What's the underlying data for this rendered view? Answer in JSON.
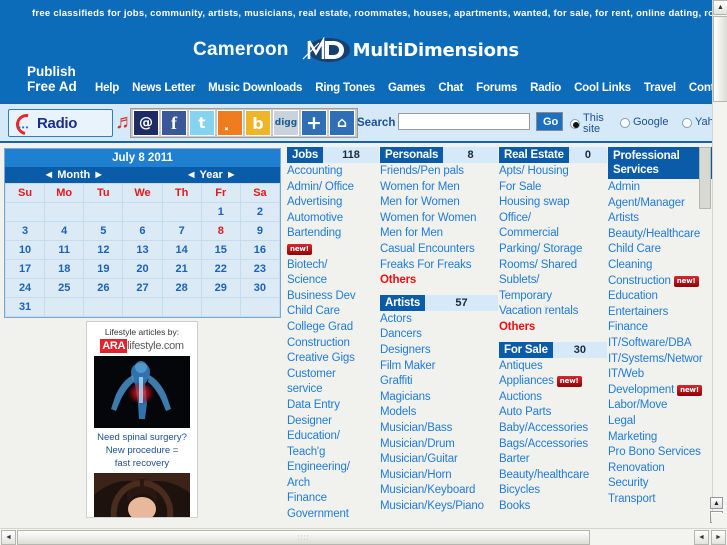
{
  "banner": {
    "tagline": "free classifieds for jobs, community, artists, musicians, real estate, roommates, houses, apartments, wanted, for sale, for rent, online dating, romance, p",
    "logo_country": "Cameroon",
    "logo_brand": "MultiDimensions",
    "publish_line1": "Publish",
    "publish_line2": "Free Ad"
  },
  "nav": {
    "items": [
      "Help",
      "News Letter",
      "Music Downloads",
      "Ring Tones",
      "Games",
      "Chat",
      "Forums",
      "Radio",
      "Cool Links",
      "Travel",
      "Contac"
    ]
  },
  "toolbar": {
    "radio_label": "Radio",
    "icons": [
      {
        "name": "email-icon",
        "glyph": "@"
      },
      {
        "name": "facebook-icon",
        "glyph": "f"
      },
      {
        "name": "twitter-icon",
        "glyph": "t"
      },
      {
        "name": "rss-icon",
        "glyph": "͓"
      },
      {
        "name": "bebo-icon",
        "glyph": "b"
      },
      {
        "name": "digg-icon",
        "glyph": "digg"
      },
      {
        "name": "addthis-icon",
        "glyph": "+"
      },
      {
        "name": "home-icon",
        "glyph": "⌂"
      }
    ],
    "search_label": "Search",
    "search_value": "",
    "search_placeholder": "",
    "go_label": "Go",
    "scope_options": [
      "This site",
      "Google",
      "Yahoo"
    ],
    "scope_selected": "This site"
  },
  "calendar": {
    "title": "July 8 2011",
    "month_nav": "◄ Month ►",
    "year_nav": "◄ Year ►",
    "daynames": [
      "Su",
      "Mo",
      "Tu",
      "We",
      "Th",
      "Fr",
      "Sa"
    ],
    "weeks": [
      [
        "",
        "",
        "",
        "",
        "",
        "1",
        "2"
      ],
      [
        "3",
        "4",
        "5",
        "6",
        "7",
        "8",
        "9"
      ],
      [
        "10",
        "11",
        "12",
        "13",
        "14",
        "15",
        "16"
      ],
      [
        "17",
        "18",
        "19",
        "20",
        "21",
        "22",
        "23"
      ],
      [
        "24",
        "25",
        "26",
        "27",
        "28",
        "29",
        "30"
      ],
      [
        "31",
        "",
        "",
        "",
        "",
        "",
        ""
      ]
    ],
    "today": "8"
  },
  "ad": {
    "header": "Lifestyle articles by:",
    "logo_red": "ARA",
    "logo_rest": "lifestyle.com",
    "caption_line1": "Need spinal surgery?",
    "caption_line2": "New procedure =",
    "caption_line3": "fast recovery"
  },
  "categories": [
    {
      "id": "jobs",
      "title": "Jobs",
      "count": "118",
      "items": [
        {
          "label": "Accounting"
        },
        {
          "label": "Admin/ Office"
        },
        {
          "label": "Advertising"
        },
        {
          "label": "Automotive"
        },
        {
          "label": "Bartending"
        },
        {
          "label": "",
          "badge": "new!"
        },
        {
          "label": "Biotech/"
        },
        {
          "label": "Science"
        },
        {
          "label": "Business Dev"
        },
        {
          "label": "Child Care"
        },
        {
          "label": "College Grad"
        },
        {
          "label": "Construction"
        },
        {
          "label": "Creative Gigs"
        },
        {
          "label": "Customer"
        },
        {
          "label": "service"
        },
        {
          "label": "Data Entry"
        },
        {
          "label": "Designer"
        },
        {
          "label": "Education/"
        },
        {
          "label": "Teach'g"
        },
        {
          "label": "Engineering/"
        },
        {
          "label": "Arch"
        },
        {
          "label": "Finance"
        },
        {
          "label": "Government"
        }
      ]
    },
    {
      "id": "personals",
      "title": "Personals",
      "count": "8",
      "items": [
        {
          "label": "Friends/Pen pals"
        },
        {
          "label": "Women for Men"
        },
        {
          "label": "Men for Women"
        },
        {
          "label": "Women for Women"
        },
        {
          "label": "Men for Men"
        },
        {
          "label": "Casual Encounters"
        },
        {
          "label": "Freaks For Freaks"
        },
        {
          "label": "Others",
          "others": true
        }
      ]
    },
    {
      "id": "artists",
      "title": "Artists",
      "count": "57",
      "items": [
        {
          "label": "Actors"
        },
        {
          "label": "Dancers"
        },
        {
          "label": "Designers"
        },
        {
          "label": "Film Maker"
        },
        {
          "label": "Graffiti"
        },
        {
          "label": "Magicians"
        },
        {
          "label": "Models"
        },
        {
          "label": "Musician/Bass"
        },
        {
          "label": "Musician/Drum"
        },
        {
          "label": "Musician/Guitar"
        },
        {
          "label": "Musician/Horn"
        },
        {
          "label": "Musician/Keyboard"
        },
        {
          "label": "Musician/Keys/Piano"
        }
      ]
    },
    {
      "id": "real-estate",
      "title": "Real Estate",
      "count": "0",
      "items": [
        {
          "label": "Apts/ Housing"
        },
        {
          "label": "For Sale"
        },
        {
          "label": "Housing swap"
        },
        {
          "label": "Office/"
        },
        {
          "label": "Commercial"
        },
        {
          "label": "Parking/ Storage"
        },
        {
          "label": "Rooms/ Shared"
        },
        {
          "label": "Sublets/"
        },
        {
          "label": "Temporary"
        },
        {
          "label": "Vacation rentals"
        },
        {
          "label": "Others",
          "others": true
        }
      ]
    },
    {
      "id": "for-sale",
      "title": "For Sale",
      "count": "30",
      "items": [
        {
          "label": "Antiques"
        },
        {
          "label": "Appliances",
          "badge": "new!"
        },
        {
          "label": "Auctions"
        },
        {
          "label": "Auto Parts"
        },
        {
          "label": "Baby/Accessories"
        },
        {
          "label": "Bags/Accessories"
        },
        {
          "label": "Barter"
        },
        {
          "label": "Beauty/healthcare"
        },
        {
          "label": "Bicycles"
        },
        {
          "label": "Books"
        }
      ]
    },
    {
      "id": "professional-services",
      "title": "Professional Services",
      "count": "",
      "items": [
        {
          "label": "Admin"
        },
        {
          "label": "Agent/Manager"
        },
        {
          "label": "Artists"
        },
        {
          "label": "Beauty/Healthcare"
        },
        {
          "label": "Child Care"
        },
        {
          "label": "Cleaning"
        },
        {
          "label": "Construction",
          "badge": "new!"
        },
        {
          "label": "Education"
        },
        {
          "label": "Entertainers"
        },
        {
          "label": "Finance"
        },
        {
          "label": "IT/Software/DBA"
        },
        {
          "label": "IT/Systems/Networ"
        },
        {
          "label": "IT/Web"
        },
        {
          "label": "Development",
          "badge": "new!"
        },
        {
          "label": "Labor/Move"
        },
        {
          "label": "Legal"
        },
        {
          "label": "Marketing"
        },
        {
          "label": "Pro Bono Services"
        },
        {
          "label": "Renovation"
        },
        {
          "label": "Security"
        },
        {
          "label": "Transport"
        }
      ]
    }
  ],
  "colors": {
    "banner_blue": "#0d6cb9",
    "header_blue": "#0b5ca8",
    "link_blue": "#1f7cd8",
    "accent_red": "#ee1111",
    "toolbar_bg": "#d6e9f8"
  },
  "scrollbars": {
    "up_arrow": "▲",
    "down_arrow": "▼",
    "left_arrow": "◄",
    "right_arrow": "►"
  }
}
